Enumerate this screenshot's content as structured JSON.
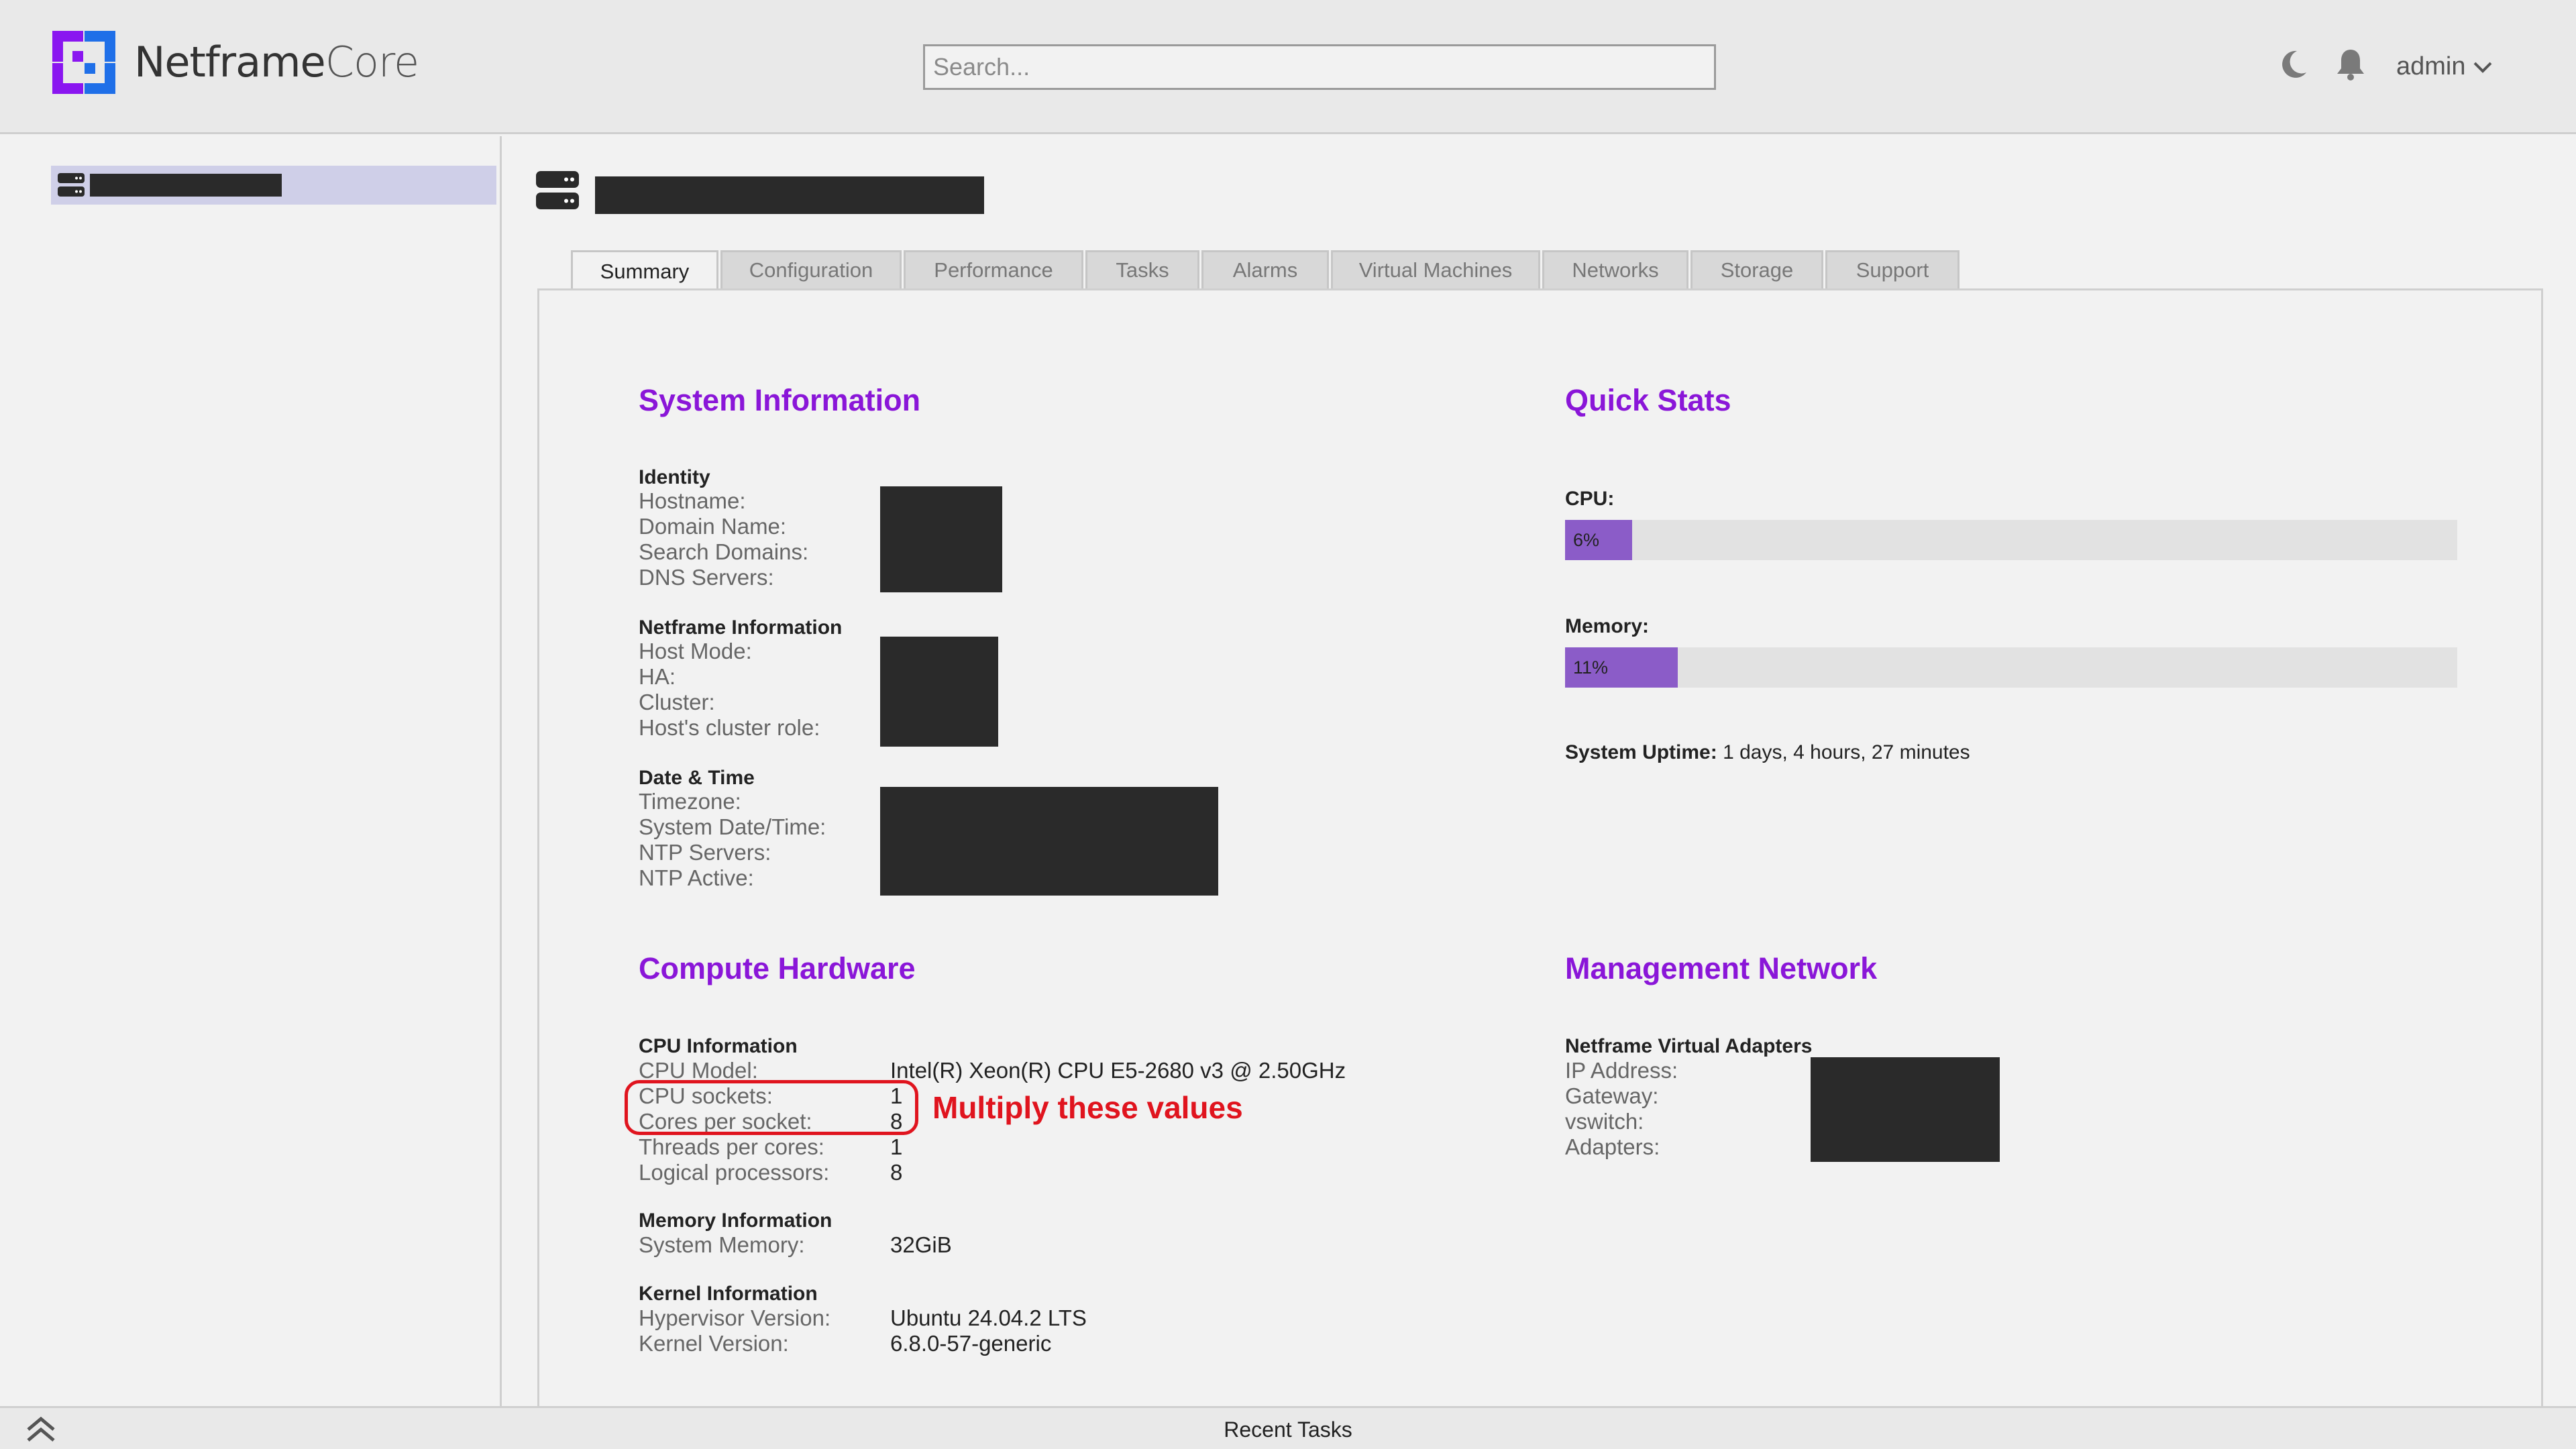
{
  "header": {
    "brand_first": "Netframe",
    "brand_second": "Core",
    "search_placeholder": "Search...",
    "user_name": "admin",
    "icons": [
      "moon-icon",
      "bell-icon",
      "chevron-down-icon"
    ],
    "brand_colors": {
      "logo_purple": "#8a16f0",
      "logo_blue": "#1f6fe8"
    }
  },
  "tabs": [
    {
      "label": "Summary",
      "active": true
    },
    {
      "label": "Configuration"
    },
    {
      "label": "Performance"
    },
    {
      "label": "Tasks"
    },
    {
      "label": "Alarms"
    },
    {
      "label": "Virtual Machines"
    },
    {
      "label": "Networks"
    },
    {
      "label": "Storage"
    },
    {
      "label": "Support"
    }
  ],
  "system_info": {
    "title": "System Information",
    "identity": {
      "title": "Identity",
      "labels": [
        "Hostname:",
        "Domain Name:",
        "Search Domains:",
        "DNS Servers:"
      ]
    },
    "netframe": {
      "title": "Netframe Information",
      "labels": [
        "Host Mode:",
        "HA:",
        "Cluster:",
        "Host's cluster role:"
      ]
    },
    "datetime": {
      "title": "Date & Time",
      "labels": [
        "Timezone:",
        "System Date/Time:",
        "NTP Servers:",
        "NTP Active:"
      ]
    }
  },
  "quick_stats": {
    "title": "Quick Stats",
    "cpu_label": "CPU:",
    "cpu_value": "6%",
    "cpu_fraction": 0.06,
    "memory_label": "Memory:",
    "memory_value": "11%",
    "memory_fraction": 0.11,
    "uptime_label": "System Uptime:",
    "uptime_value": "1 days, 4 hours, 27 minutes",
    "bar_color": "#8b5cc8"
  },
  "compute": {
    "title": "Compute Hardware",
    "cpu": {
      "title": "CPU Information",
      "rows": [
        {
          "label": "CPU Model:",
          "value": "Intel(R) Xeon(R) CPU E5-2680 v3 @ 2.50GHz"
        },
        {
          "label": "CPU sockets:",
          "value": "1"
        },
        {
          "label": "Cores per socket:",
          "value": "8"
        },
        {
          "label": "Threads per cores:",
          "value": "1"
        },
        {
          "label": "Logical processors:",
          "value": "8"
        }
      ]
    },
    "memory": {
      "title": "Memory Information",
      "rows": [
        {
          "label": "System Memory:",
          "value": "32GiB"
        }
      ]
    },
    "kernel": {
      "title": "Kernel Information",
      "rows": [
        {
          "label": "Hypervisor Version:",
          "value": "Ubuntu 24.04.2 LTS"
        },
        {
          "label": "Kernel Version:",
          "value": "6.8.0-57-generic"
        }
      ]
    }
  },
  "management": {
    "title": "Management Network",
    "adapters": {
      "title": "Netframe Virtual Adapters",
      "labels": [
        "IP Address:",
        "Gateway:",
        "vswitch:",
        "Adapters:"
      ]
    }
  },
  "annotation": {
    "text": "Multiply these values",
    "color": "#e0141e"
  },
  "footer": {
    "label": "Recent Tasks"
  },
  "accent_color": "#8a16d8"
}
